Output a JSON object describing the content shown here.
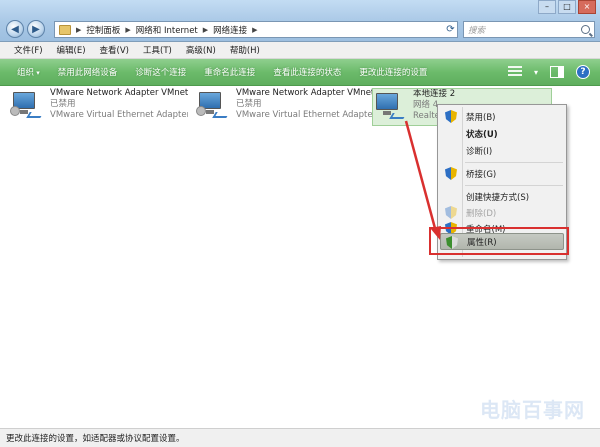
{
  "address_bar": {
    "breadcrumbs": [
      "控制面板",
      "网络和 Internet",
      "网络连接"
    ],
    "search_placeholder": "搜索"
  },
  "menu": {
    "items": [
      "文件(F)",
      "编辑(E)",
      "查看(V)",
      "工具(T)",
      "高级(N)",
      "帮助(H)"
    ]
  },
  "command_bar": {
    "items": [
      "组织",
      "禁用此网络设备",
      "诊断这个连接",
      "重命名此连接",
      "查看此连接的状态",
      "更改此连接的设置"
    ]
  },
  "adapters": [
    {
      "name": "VMware Network Adapter VMnet1",
      "status": "已禁用",
      "device": "VMware Virtual Ethernet Adapter ..."
    },
    {
      "name": "VMware Network Adapter VMnet8",
      "status": "已禁用",
      "device": "VMware Virtual Ethernet Adapter ..."
    },
    {
      "name": "本地连接 2",
      "status": "网络 4",
      "device": "Realte"
    }
  ],
  "context_menu": {
    "items": [
      "禁用(B)",
      "状态(U)",
      "诊断(I)",
      "桥接(G)",
      "创建快捷方式(S)",
      "删除(D)",
      "重命名(M)",
      "属性(R)"
    ]
  },
  "status_bar": {
    "text": "更改此连接的设置，如适配器或协议配置设置。"
  },
  "watermark": "电脑百事网",
  "colors": {
    "command_bar": "#6cbb6b",
    "selection": "#dcefd9",
    "annotation_red": "#d9302f"
  }
}
